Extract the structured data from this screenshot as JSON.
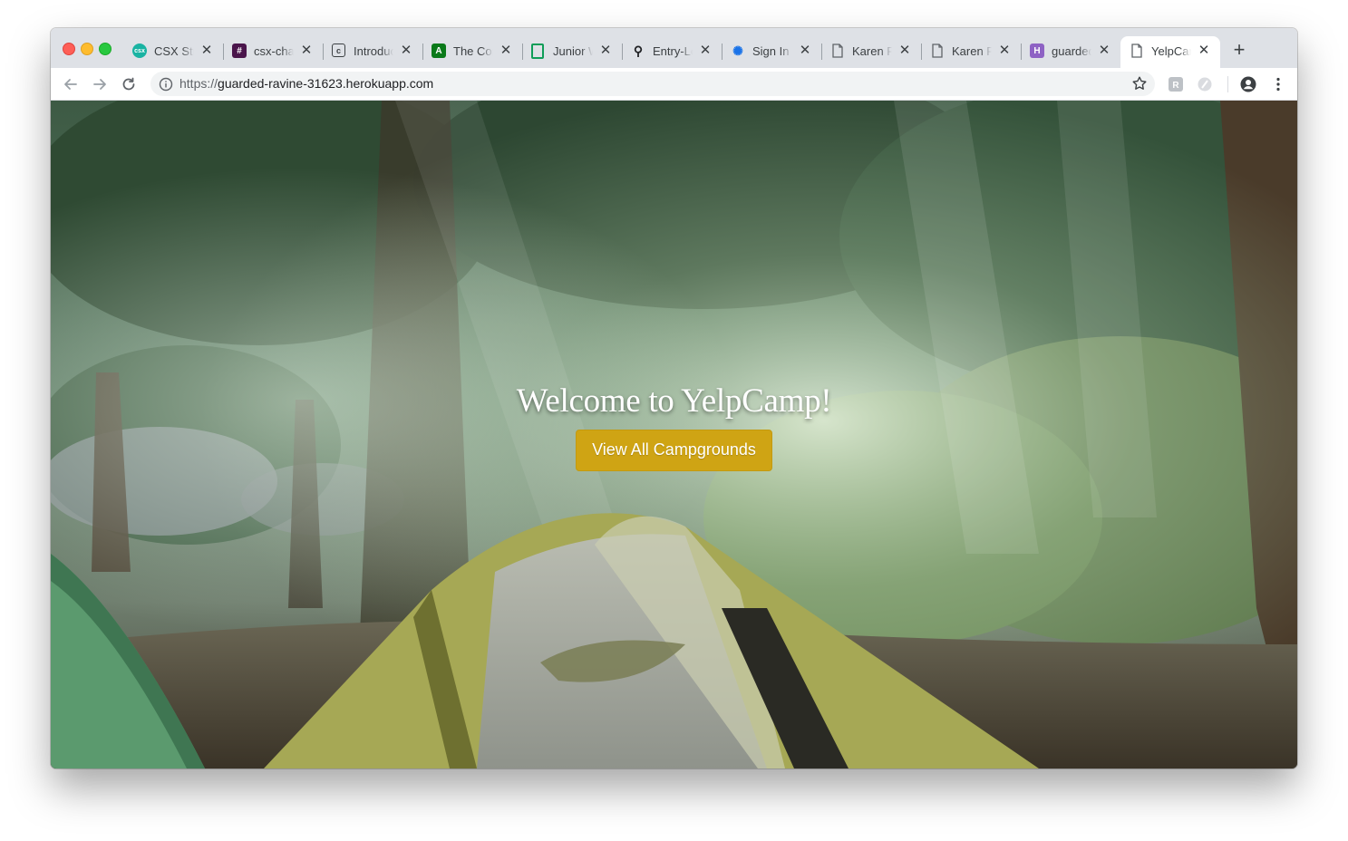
{
  "browser": {
    "tabs": [
      {
        "title": "CSX Strategy",
        "favicon": "csx-icon",
        "color": "#19b3a2",
        "active": false
      },
      {
        "title": "csx-chat",
        "favicon": "slack-icon",
        "color": "#4a154b",
        "active": false
      },
      {
        "title": "Introduction",
        "favicon": "codepen-icon",
        "color": "#3c4043",
        "active": false
      },
      {
        "title": "The Complete",
        "favicon": "angular-icon",
        "color": "#0a7a1a",
        "active": false
      },
      {
        "title": "Junior Web",
        "favicon": "document-green-icon",
        "color": "#0f9d58",
        "active": false
      },
      {
        "title": "Entry-Level",
        "favicon": "bike-icon",
        "color": "#202124",
        "active": false
      },
      {
        "title": "Sign In",
        "favicon": "bulb-icon",
        "color": "#1a73e8",
        "active": false
      },
      {
        "title": "Karen Pi",
        "favicon": "page-icon",
        "color": "#5f6368",
        "active": false
      },
      {
        "title": "Karen Pi",
        "favicon": "page-icon",
        "color": "#5f6368",
        "active": false
      },
      {
        "title": "guarded",
        "favicon": "heroku-icon",
        "color": "#8e62c4",
        "active": false
      },
      {
        "title": "YelpCamp",
        "favicon": "page-icon",
        "color": "#5f6368",
        "active": true
      }
    ],
    "close_glyph": "✕",
    "new_tab_glyph": "+",
    "url_scheme": "https://",
    "url_host": "guarded-ravine-31623.herokuapp.com"
  },
  "page": {
    "title": "Welcome to YelpCamp!",
    "cta_label": "View All Campgrounds"
  },
  "colors": {
    "cta": "#cfa414",
    "tabstrip": "#dee1e6"
  }
}
